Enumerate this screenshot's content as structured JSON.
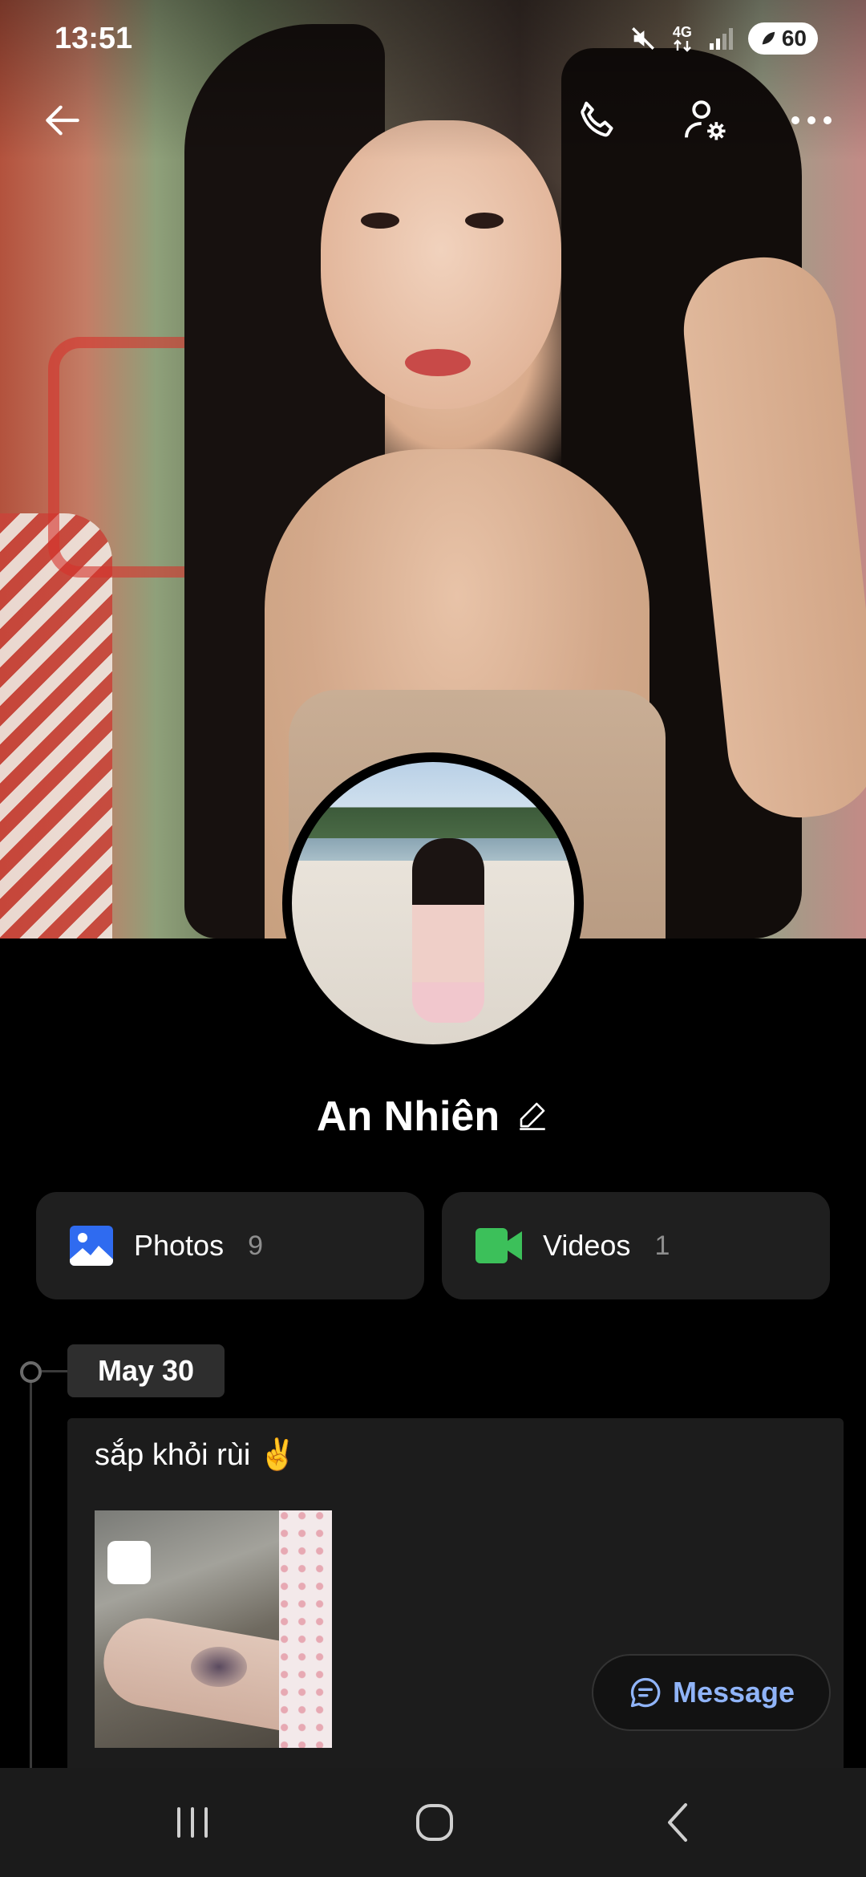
{
  "status_bar": {
    "time": "13:51",
    "network_label": "4G",
    "battery_level": "60",
    "icons": [
      "mute-icon",
      "network-4g-icon",
      "signal-icon",
      "battery-icon"
    ]
  },
  "top_bar": {
    "icons": [
      "back-arrow-icon",
      "phone-call-icon",
      "profile-settings-icon",
      "more-horizontal-icon"
    ]
  },
  "profile": {
    "name": "An Nhiên",
    "edit_icon": "pencil-icon"
  },
  "media": {
    "photos": {
      "label": "Photos",
      "count": "9",
      "icon": "image-icon",
      "color": "#2f6bf0"
    },
    "videos": {
      "label": "Videos",
      "count": "1",
      "icon": "video-camera-icon",
      "color": "#3cc05a"
    }
  },
  "timeline": {
    "entries": [
      {
        "date": "May 30",
        "text": "sắp khỏi rùi ✌️",
        "image_badge": "😨"
      }
    ]
  },
  "message_button": {
    "label": "Message",
    "icon": "chat-bubble-icon",
    "color": "#90b4f8"
  },
  "nav_bar": {
    "icons": [
      "recent-apps-icon",
      "home-icon",
      "nav-back-icon"
    ]
  }
}
